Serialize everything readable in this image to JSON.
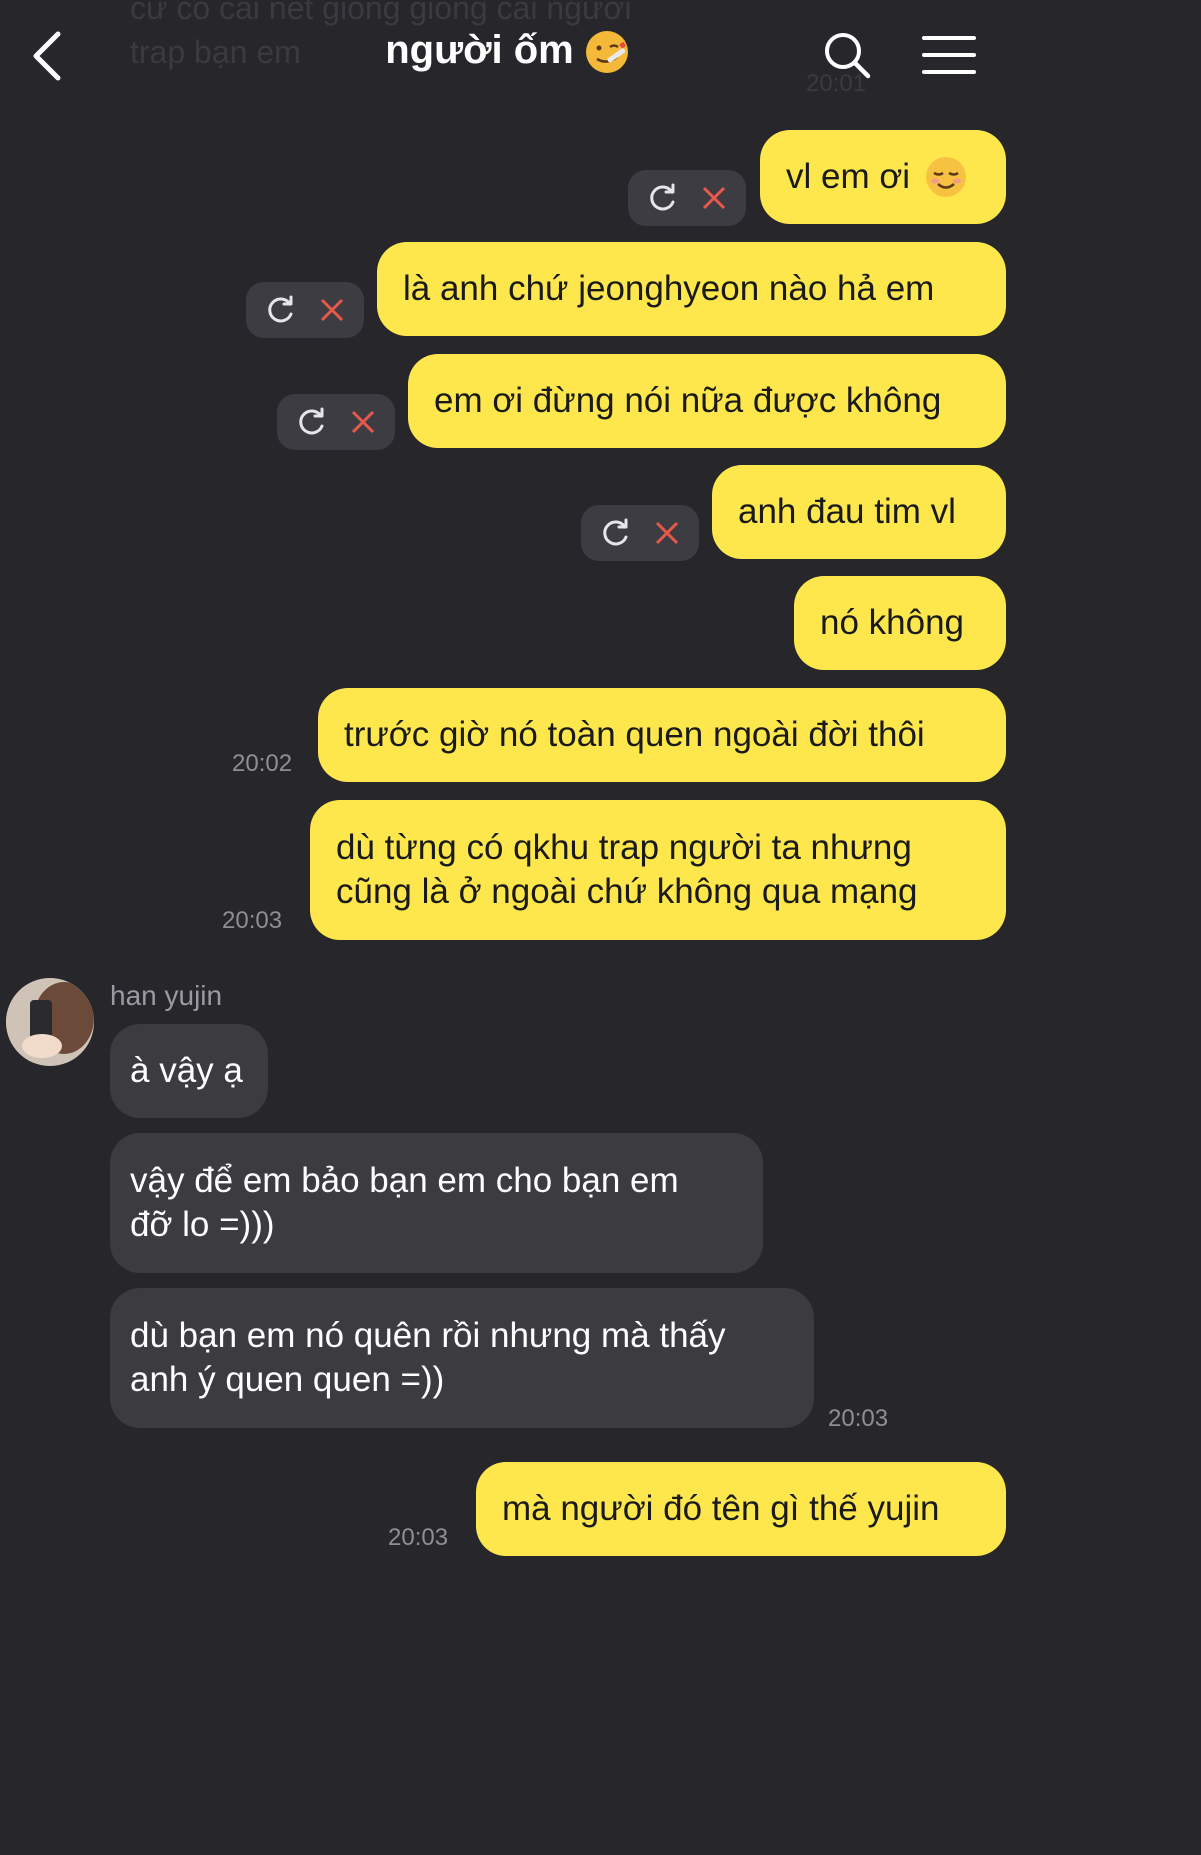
{
  "header": {
    "title": "người ốm",
    "background_text": "cứ có cái nết giống giống cái người\ntrap bạn em",
    "background_time": "20:01"
  },
  "messages": [
    {
      "from": "me",
      "text": "vl em ơi",
      "emoji": "relieved-smile",
      "failed": true
    },
    {
      "from": "me",
      "text": "là anh chứ jeonghyeon nào hả em",
      "failed": true
    },
    {
      "from": "me",
      "text": "em ơi đừng nói nữa được không",
      "failed": true
    },
    {
      "from": "me",
      "text": "anh đau tim vl",
      "failed": true
    },
    {
      "from": "me",
      "text": "nó không"
    },
    {
      "from": "me",
      "text": "trước giờ nó toàn quen ngoài đời thôi",
      "time": "20:02"
    },
    {
      "from": "me",
      "text": "dù từng có qkhu trap người ta nhưng\ncũng là ở ngoài chứ không qua mạng",
      "time": "20:03"
    },
    {
      "from": "them",
      "sender": "han yujin",
      "text": "à vậy ạ"
    },
    {
      "from": "them",
      "text": "vậy để em bảo bạn em cho bạn em\nđỡ lo =)))"
    },
    {
      "from": "them",
      "text": "dù bạn em nó quên rồi nhưng mà thấy\nanh ý quen quen =))",
      "time": "20:03"
    },
    {
      "from": "me",
      "text": "mà người đó tên gì thế yujin",
      "time": "20:03"
    }
  ],
  "colors": {
    "background": "#27272b",
    "outgoing_bubble": "#fde74c",
    "incoming_bubble": "#3b3b40",
    "error_x": "#e8594a"
  },
  "icons": [
    "back-arrow-icon",
    "sick-face-icon",
    "search-icon",
    "menu-icon",
    "retry-icon",
    "delete-icon"
  ]
}
